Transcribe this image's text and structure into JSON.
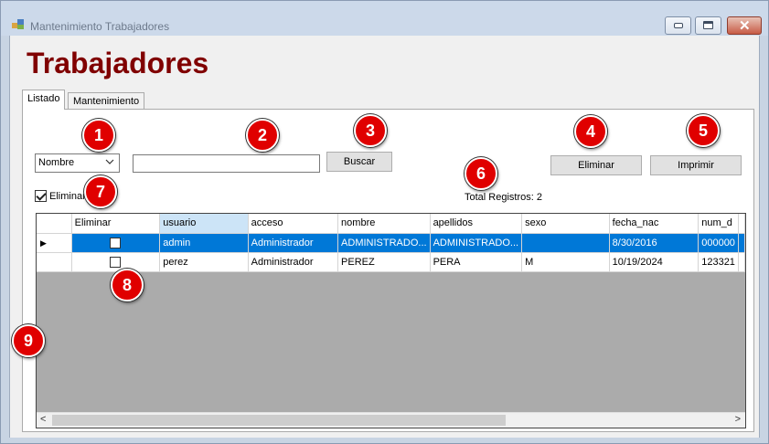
{
  "window": {
    "title": "Mantenimiento Trabajadores",
    "accent_color": "#800000",
    "selection_color": "#0078d7",
    "close_glyph": "✕"
  },
  "heading": "Trabajadores",
  "tabs": [
    {
      "label": "Listado",
      "active": true
    },
    {
      "label": "Mantenimiento",
      "active": false
    }
  ],
  "toolbar": {
    "search_field_value": "Nombre",
    "search_input_value": "",
    "buscar_label": "Buscar",
    "eliminar_label": "Eliminar",
    "imprimir_label": "Imprimir",
    "eliminar_checkbox_label": "Eliminar",
    "eliminar_checkbox_checked": true,
    "total_registros": "Total Registros: 2"
  },
  "grid": {
    "columns": [
      "Eliminar",
      "usuario",
      "acceso",
      "nombre",
      "apellidos",
      "sexo",
      "fecha_nac",
      "num_d"
    ],
    "rows": [
      {
        "selected": true,
        "eliminar": false,
        "usuario": "admin",
        "acceso": "Administrador",
        "nombre": "ADMINISTRADO...",
        "apellidos": "ADMINISTRADO...",
        "sexo": "",
        "fecha_nac": "8/30/2016",
        "num_d": "000000"
      },
      {
        "selected": false,
        "eliminar": false,
        "usuario": "perez",
        "acceso": "Administrador",
        "nombre": "PEREZ",
        "apellidos": "PERA",
        "sexo": "M",
        "fecha_nac": "10/19/2024",
        "num_d": "123321"
      }
    ]
  },
  "badges": [
    "1",
    "2",
    "3",
    "4",
    "5",
    "6",
    "7",
    "8",
    "9"
  ]
}
